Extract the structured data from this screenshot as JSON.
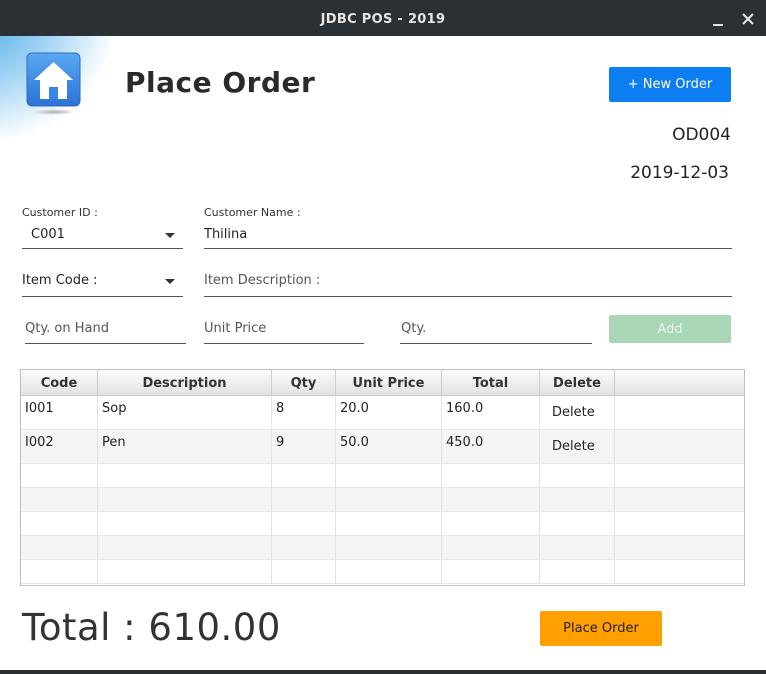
{
  "window": {
    "title": "JDBC POS - 2019"
  },
  "header": {
    "page_title": "Place Order",
    "new_order_label": "+ New Order",
    "order_id": "OD004",
    "order_date": "2019-12-03"
  },
  "form": {
    "customer_id_label": "Customer ID :",
    "customer_id_value": "C001",
    "customer_name_label": "Customer Name :",
    "customer_name_value": "Thilina",
    "item_code_label": "Item Code :",
    "item_description_placeholder": "Item Description :",
    "qty_on_hand_placeholder": "Qty. on Hand",
    "unit_price_placeholder": "Unit Price",
    "qty_placeholder": "Qty.",
    "add_label": "Add"
  },
  "table": {
    "columns": [
      "Code",
      "Description",
      "Qty",
      "Unit Price",
      "Total",
      "Delete"
    ],
    "rows": [
      {
        "code": "I001",
        "description": "Sop",
        "qty": "8",
        "unit_price": "20.0",
        "total": "160.0",
        "action": "Delete"
      },
      {
        "code": "I002",
        "description": "Pen",
        "qty": "9",
        "unit_price": "50.0",
        "total": "450.0",
        "action": "Delete"
      }
    ]
  },
  "footer": {
    "total_text": "Total : 610.00",
    "place_order_label": "Place Order"
  },
  "colors": {
    "primary": "#0d7ef2",
    "add_disabled": "#a9d7b6",
    "place_order": "#ff9f00",
    "titlebar": "#2b3035"
  },
  "icons": {
    "home": "home-icon",
    "close": "close-icon",
    "minimize": "minimize-icon",
    "dropdown": "chevron-down-icon"
  }
}
